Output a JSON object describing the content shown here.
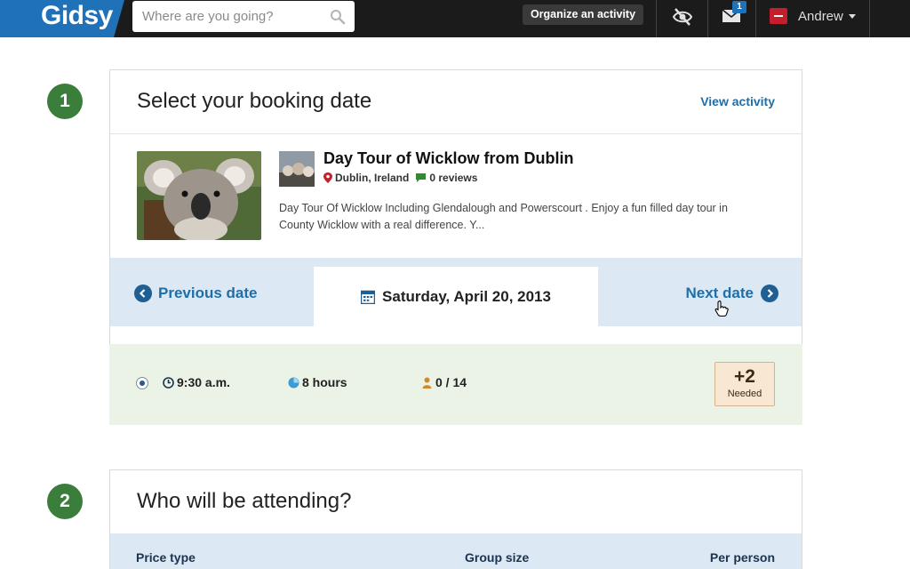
{
  "nav": {
    "logo": "Gidsy",
    "search_placeholder": "Where are you going?",
    "organize_label": "Organize an activity",
    "messages_count": "1",
    "user_name": "Andrew"
  },
  "step1": {
    "number": "1",
    "title": "Select your booking date",
    "view_activity": "View activity",
    "activity": {
      "title": "Day Tour of Wicklow from Dublin",
      "location": "Dublin, Ireland",
      "reviews": "0 reviews",
      "description": "Day Tour Of Wicklow Including Glendalough and Powerscourt . Enjoy a fun filled day tour in County Wicklow with a real difference. Y..."
    },
    "date_nav": {
      "prev": "Previous date",
      "current": "Saturday, April 20, 2013",
      "next": "Next date"
    },
    "slot": {
      "time": "9:30 a.m.",
      "duration": "8 hours",
      "capacity": "0 / 14",
      "needed_count": "+2",
      "needed_label": "Needed"
    }
  },
  "step2": {
    "number": "2",
    "title": "Who will be attending?",
    "columns": [
      "Price type",
      "Group size",
      "Per person"
    ]
  },
  "colors": {
    "brand_blue": "#1f72b8",
    "link_blue": "#1f6ea8",
    "step_green": "#3b7d3a",
    "date_bar": "#dce9f4",
    "slot_bg": "#ebf2e6",
    "needed_bg": "#f7e7d3"
  }
}
